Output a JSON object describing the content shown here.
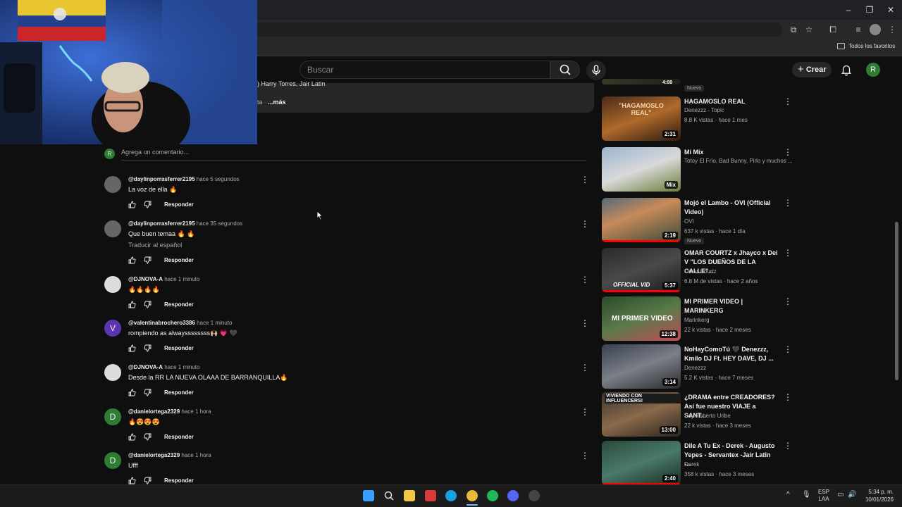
{
  "browser": {
    "bookmarks_label": "Todos los favoritos"
  },
  "header": {
    "search_placeholder": "Buscar",
    "create_label": "Crear",
    "avatar_letter": "R"
  },
  "description": {
    "partial_text": ") Harry Torres, Jair Latin",
    "partial_text2": "ta",
    "more_label": "...más"
  },
  "comment_box": {
    "avatar_letter": "R",
    "placeholder": "Agrega un comentario..."
  },
  "comments": [
    {
      "avatar": "",
      "user": "@daylinporrasferrer2195",
      "time": "hace 5 segundos",
      "text": "La voz de ella 🔥",
      "translate": ""
    },
    {
      "avatar": "",
      "user": "@daylinporrasferrer2195",
      "time": "hace 35 segundos",
      "text": "Que buen temaa 🔥 🔥",
      "translate": "Traducir al español"
    },
    {
      "avatar": "",
      "user": "@DJNOVA-A",
      "time": "hace 1 minuto",
      "text": "🔥🔥🔥🔥",
      "translate": ""
    },
    {
      "avatar": "V",
      "user": "@valentinabrochero3386",
      "time": "hace 1 minuto",
      "text": "rompiendo as alwayssssssss🙌🏼 💗 🖤",
      "translate": ""
    },
    {
      "avatar": "",
      "user": "@DJNOVA-A",
      "time": "hace 1 minuto",
      "text": "Desde la RR LA NUEVA OLAAA DE BARRANQUILLA🔥",
      "translate": ""
    },
    {
      "avatar": "D",
      "user": "@danielortega2329",
      "time": "hace 1 hora",
      "text": "🔥😍😍😍",
      "translate": ""
    },
    {
      "avatar": "D",
      "user": "@danielortega2329",
      "time": "hace 1 hora",
      "text": "Ufff",
      "translate": ""
    }
  ],
  "reply_label": "Responder",
  "related": [
    {
      "title": "",
      "channel": "",
      "meta": "",
      "duration": "4:08",
      "badge": "Nuevo"
    },
    {
      "title": "HAGAMOSLO REAL",
      "channel": "Denezzz - Topic",
      "meta": "8.8 K vistas · hace 1 mes",
      "duration": "2:31",
      "badge": ""
    },
    {
      "title": "Mi Mix",
      "channel": "Totoy El Frío, Bad Bunny, Pirlo y muchos ...",
      "meta": "",
      "duration": "Mix",
      "badge": ""
    },
    {
      "title": "Mojó el Lambo - OVI (Official Video)",
      "channel": "OVI",
      "meta": "637 k vistas · hace 1 día",
      "duration": "2:19",
      "badge": "Nuevo"
    },
    {
      "title": "OMAR COURTZ x Jhayco x Dei V \"LOS DUEÑOS DE LA CALLE\"...",
      "channel": "Omar Courtz",
      "meta": "6.8 M de vistas · hace 2 años",
      "duration": "5:37",
      "badge": ""
    },
    {
      "title": "MI PRIMER VIDEO | MARINKERG",
      "channel": "Marinkerg",
      "meta": "22 k vistas · hace 2 meses",
      "duration": "12:38",
      "badge": ""
    },
    {
      "title": "NoHayComoTú 🖤 Denezzz, Kmilo DJ Ft. HEY DAVE, DJ ...",
      "channel": "Denezzz",
      "meta": "5.2 K vistas · hace 7 meses",
      "duration": "3:14",
      "badge": ""
    },
    {
      "title": "¿DRAMA entre CREADORES? Así fue nuestro VIAJE a SANT...",
      "channel": "Soy Roberto Uribe",
      "meta": "22 k vistas · hace 3 meses",
      "duration": "13:00",
      "badge": ""
    },
    {
      "title": "Dile A Tu Ex - Derek - Augusto Yepes - Servantex -Jair Latin -...",
      "channel": "Derek",
      "meta": "358 k vistas · hace 3 meses",
      "duration": "2:40",
      "badge": ""
    }
  ],
  "thumb_texts": {
    "hagamoslo": "\"HAGAMOSLO REAL\"",
    "primer": "MI PRIMER VIDEO",
    "viviendo": "VIVIENDO CON INFLUENCERS!",
    "official": "OFFICIAL VID"
  },
  "taskbar": {
    "lang_line1": "ESP",
    "lang_line2": "LAA",
    "time": "5:34 p. m.",
    "date": "10/01/2026"
  },
  "colors": {
    "accent_red": "#ff0000",
    "avatar_green": "#2e7d32",
    "avatar_purple": "#5e35b1"
  }
}
